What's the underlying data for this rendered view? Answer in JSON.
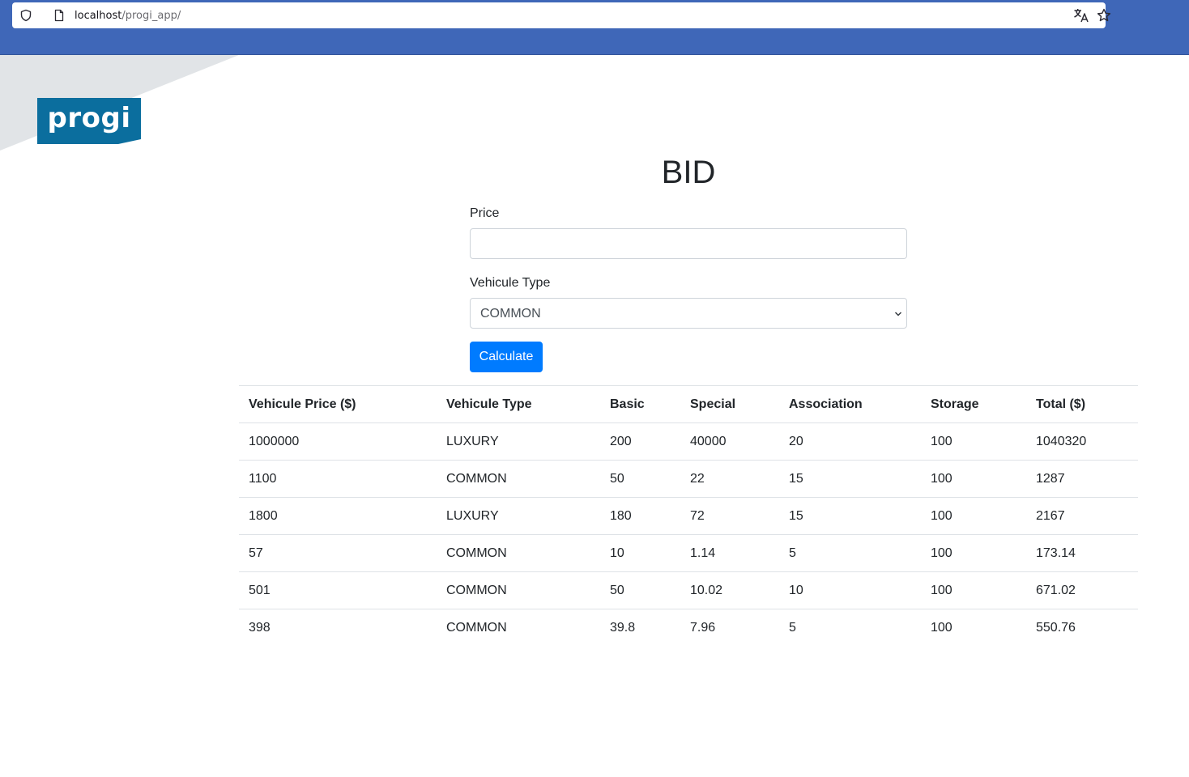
{
  "browser": {
    "url_host": "localhost",
    "url_path": "/progi_app/",
    "icons": [
      "shield-icon",
      "page-icon",
      "translate-icon",
      "star-icon"
    ]
  },
  "logo": {
    "text": "progi",
    "color": "#0b6e9e"
  },
  "form": {
    "title": "BID",
    "price_label": "Price",
    "price_value": "",
    "type_label": "Vehicule Type",
    "type_selected": "COMMON",
    "calculate_label": "Calculate"
  },
  "table": {
    "headers": [
      "Vehicule Price ($)",
      "Vehicule Type",
      "Basic",
      "Special",
      "Association",
      "Storage",
      "Total ($)"
    ],
    "rows": [
      [
        "1000000",
        "LUXURY",
        "200",
        "40000",
        "20",
        "100",
        "1040320"
      ],
      [
        "1100",
        "COMMON",
        "50",
        "22",
        "15",
        "100",
        "1287"
      ],
      [
        "1800",
        "LUXURY",
        "180",
        "72",
        "15",
        "100",
        "2167"
      ],
      [
        "57",
        "COMMON",
        "10",
        "1.14",
        "5",
        "100",
        "173.14"
      ],
      [
        "501",
        "COMMON",
        "50",
        "10.02",
        "10",
        "100",
        "671.02"
      ],
      [
        "398",
        "COMMON",
        "39.8",
        "7.96",
        "5",
        "100",
        "550.76"
      ]
    ]
  },
  "colors": {
    "browser_bar": "#3f67b8",
    "primary_button": "#007bff",
    "logo_bg": "#0b6e9e"
  }
}
